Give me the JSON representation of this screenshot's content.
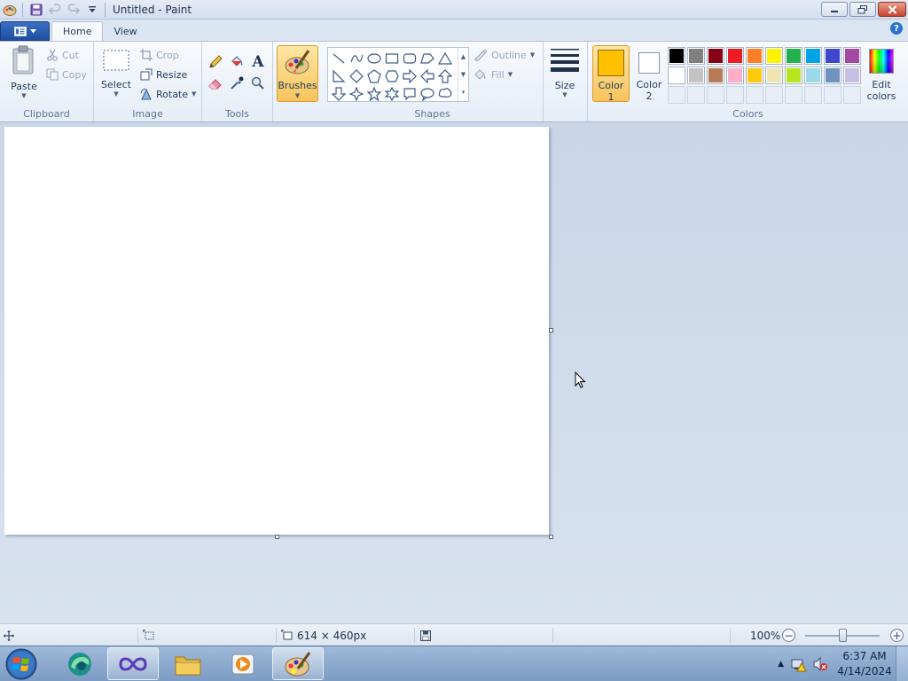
{
  "window": {
    "title": "Untitled - Paint"
  },
  "tabs": [
    {
      "label": "Home",
      "active": true
    },
    {
      "label": "View",
      "active": false
    }
  ],
  "clipboard": {
    "paste_label": "Paste",
    "cut_label": "Cut",
    "copy_label": "Copy",
    "group_label": "Clipboard"
  },
  "image": {
    "select_label": "Select",
    "crop_label": "Crop",
    "resize_label": "Resize",
    "rotate_label": "Rotate",
    "group_label": "Image"
  },
  "tools": {
    "group_label": "Tools",
    "text_glyph": "A"
  },
  "brushes": {
    "label": "Brushes"
  },
  "shapes": {
    "outline_label": "Outline",
    "fill_label": "Fill",
    "group_label": "Shapes"
  },
  "size": {
    "label": "Size"
  },
  "colors": {
    "color1_label_line1": "Color",
    "color1_label_line2": "1",
    "color2_label_line1": "Color",
    "color2_label_line2": "2",
    "edit_label_line1": "Edit",
    "edit_label_line2": "colors",
    "group_label": "Colors",
    "color1_value": "#ffc000",
    "color2_value": "#ffffff",
    "palette_row1": [
      "#000000",
      "#7f7f7f",
      "#880015",
      "#ed1c24",
      "#ff7f27",
      "#fff200",
      "#22b14c",
      "#00a2e8",
      "#3f48cc",
      "#a349a4"
    ],
    "palette_row2": [
      "#ffffff",
      "#c3c3c3",
      "#b97a57",
      "#ffaec9",
      "#ffc90e",
      "#efe4b0",
      "#b5e61d",
      "#99d9ea",
      "#7092be",
      "#c8bfe7"
    ]
  },
  "statusbar": {
    "canvas_size": "614 × 460px",
    "zoom": "100%",
    "zoom_level": 0.5
  },
  "taskbar": {
    "time": "6:37 AM",
    "date": "4/14/2024"
  }
}
